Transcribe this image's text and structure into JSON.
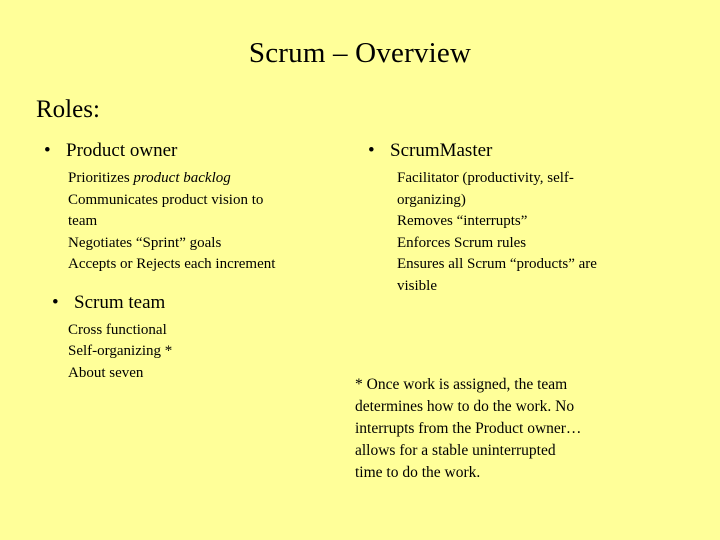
{
  "slide": {
    "title": "Scrum – Overview",
    "section_heading": "Roles:",
    "background_color": "#ffff99",
    "text_color": "#000000",
    "bullet_glyph": "•"
  },
  "left_column": {
    "groups": [
      {
        "bullet": "Product owner",
        "details": [
          {
            "prefix": "Prioritizes ",
            "emphasis": "product backlog",
            "suffix": ""
          },
          {
            "prefix": "Communicates product vision to",
            "emphasis": "",
            "suffix": ""
          },
          {
            "prefix": "team",
            "emphasis": "",
            "suffix": ""
          },
          {
            "prefix": "Negotiates  “Sprint” goals",
            "emphasis": "",
            "suffix": ""
          },
          {
            "prefix": "Accepts or Rejects each increment",
            "emphasis": "",
            "suffix": ""
          }
        ]
      },
      {
        "bullet": "Scrum team",
        "details": [
          {
            "prefix": "Cross functional",
            "emphasis": "",
            "suffix": ""
          },
          {
            "prefix": "Self-organizing *",
            "emphasis": "",
            "suffix": ""
          },
          {
            "prefix": "About seven",
            "emphasis": "",
            "suffix": ""
          }
        ]
      }
    ]
  },
  "right_column": {
    "groups": [
      {
        "bullet": "ScrumMaster",
        "details": [
          {
            "prefix": "Facilitator (productivity, self-",
            "emphasis": "",
            "suffix": ""
          },
          {
            "prefix": "organizing)",
            "emphasis": "",
            "suffix": ""
          },
          {
            "prefix": "Removes “interrupts”",
            "emphasis": "",
            "suffix": ""
          },
          {
            "prefix": "Enforces Scrum rules",
            "emphasis": "",
            "suffix": ""
          },
          {
            "prefix": "Ensures all Scrum “products” are",
            "emphasis": "",
            "suffix": ""
          },
          {
            "prefix": "visible",
            "emphasis": "",
            "suffix": ""
          }
        ]
      }
    ]
  },
  "footnote": {
    "lines": [
      "* Once work is assigned, the team",
      "determines how to do the work. No",
      "interrupts from the Product owner…",
      "allows for a stable uninterrupted",
      "time to do the work."
    ]
  }
}
